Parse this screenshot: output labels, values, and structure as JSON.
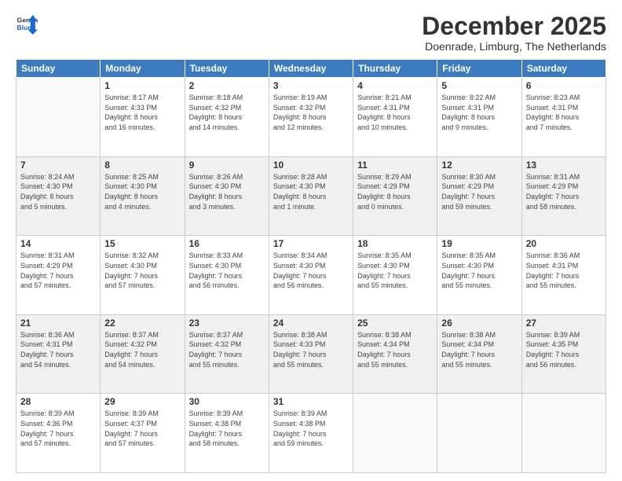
{
  "logo": {
    "general": "General",
    "blue": "Blue"
  },
  "header": {
    "month": "December 2025",
    "location": "Doenrade, Limburg, The Netherlands"
  },
  "weekdays": [
    "Sunday",
    "Monday",
    "Tuesday",
    "Wednesday",
    "Thursday",
    "Friday",
    "Saturday"
  ],
  "weeks": [
    [
      {
        "day": "",
        "info": ""
      },
      {
        "day": "1",
        "info": "Sunrise: 8:17 AM\nSunset: 4:33 PM\nDaylight: 8 hours\nand 16 minutes."
      },
      {
        "day": "2",
        "info": "Sunrise: 8:18 AM\nSunset: 4:32 PM\nDaylight: 8 hours\nand 14 minutes."
      },
      {
        "day": "3",
        "info": "Sunrise: 8:19 AM\nSunset: 4:32 PM\nDaylight: 8 hours\nand 12 minutes."
      },
      {
        "day": "4",
        "info": "Sunrise: 8:21 AM\nSunset: 4:31 PM\nDaylight: 8 hours\nand 10 minutes."
      },
      {
        "day": "5",
        "info": "Sunrise: 8:22 AM\nSunset: 4:31 PM\nDaylight: 8 hours\nand 9 minutes."
      },
      {
        "day": "6",
        "info": "Sunrise: 8:23 AM\nSunset: 4:31 PM\nDaylight: 8 hours\nand 7 minutes."
      }
    ],
    [
      {
        "day": "7",
        "info": "Sunrise: 8:24 AM\nSunset: 4:30 PM\nDaylight: 8 hours\nand 5 minutes."
      },
      {
        "day": "8",
        "info": "Sunrise: 8:25 AM\nSunset: 4:30 PM\nDaylight: 8 hours\nand 4 minutes."
      },
      {
        "day": "9",
        "info": "Sunrise: 8:26 AM\nSunset: 4:30 PM\nDaylight: 8 hours\nand 3 minutes."
      },
      {
        "day": "10",
        "info": "Sunrise: 8:28 AM\nSunset: 4:30 PM\nDaylight: 8 hours\nand 1 minute."
      },
      {
        "day": "11",
        "info": "Sunrise: 8:29 AM\nSunset: 4:29 PM\nDaylight: 8 hours\nand 0 minutes."
      },
      {
        "day": "12",
        "info": "Sunrise: 8:30 AM\nSunset: 4:29 PM\nDaylight: 7 hours\nand 59 minutes."
      },
      {
        "day": "13",
        "info": "Sunrise: 8:31 AM\nSunset: 4:29 PM\nDaylight: 7 hours\nand 58 minutes."
      }
    ],
    [
      {
        "day": "14",
        "info": "Sunrise: 8:31 AM\nSunset: 4:29 PM\nDaylight: 7 hours\nand 57 minutes."
      },
      {
        "day": "15",
        "info": "Sunrise: 8:32 AM\nSunset: 4:30 PM\nDaylight: 7 hours\nand 57 minutes."
      },
      {
        "day": "16",
        "info": "Sunrise: 8:33 AM\nSunset: 4:30 PM\nDaylight: 7 hours\nand 56 minutes."
      },
      {
        "day": "17",
        "info": "Sunrise: 8:34 AM\nSunset: 4:30 PM\nDaylight: 7 hours\nand 56 minutes."
      },
      {
        "day": "18",
        "info": "Sunrise: 8:35 AM\nSunset: 4:30 PM\nDaylight: 7 hours\nand 55 minutes."
      },
      {
        "day": "19",
        "info": "Sunrise: 8:35 AM\nSunset: 4:30 PM\nDaylight: 7 hours\nand 55 minutes."
      },
      {
        "day": "20",
        "info": "Sunrise: 8:36 AM\nSunset: 4:31 PM\nDaylight: 7 hours\nand 55 minutes."
      }
    ],
    [
      {
        "day": "21",
        "info": "Sunrise: 8:36 AM\nSunset: 4:31 PM\nDaylight: 7 hours\nand 54 minutes."
      },
      {
        "day": "22",
        "info": "Sunrise: 8:37 AM\nSunset: 4:32 PM\nDaylight: 7 hours\nand 54 minutes."
      },
      {
        "day": "23",
        "info": "Sunrise: 8:37 AM\nSunset: 4:32 PM\nDaylight: 7 hours\nand 55 minutes."
      },
      {
        "day": "24",
        "info": "Sunrise: 8:38 AM\nSunset: 4:33 PM\nDaylight: 7 hours\nand 55 minutes."
      },
      {
        "day": "25",
        "info": "Sunrise: 8:38 AM\nSunset: 4:34 PM\nDaylight: 7 hours\nand 55 minutes."
      },
      {
        "day": "26",
        "info": "Sunrise: 8:38 AM\nSunset: 4:34 PM\nDaylight: 7 hours\nand 55 minutes."
      },
      {
        "day": "27",
        "info": "Sunrise: 8:39 AM\nSunset: 4:35 PM\nDaylight: 7 hours\nand 56 minutes."
      }
    ],
    [
      {
        "day": "28",
        "info": "Sunrise: 8:39 AM\nSunset: 4:36 PM\nDaylight: 7 hours\nand 57 minutes."
      },
      {
        "day": "29",
        "info": "Sunrise: 8:39 AM\nSunset: 4:37 PM\nDaylight: 7 hours\nand 57 minutes."
      },
      {
        "day": "30",
        "info": "Sunrise: 8:39 AM\nSunset: 4:38 PM\nDaylight: 7 hours\nand 58 minutes."
      },
      {
        "day": "31",
        "info": "Sunrise: 8:39 AM\nSunset: 4:38 PM\nDaylight: 7 hours\nand 59 minutes."
      },
      {
        "day": "",
        "info": ""
      },
      {
        "day": "",
        "info": ""
      },
      {
        "day": "",
        "info": ""
      }
    ]
  ]
}
